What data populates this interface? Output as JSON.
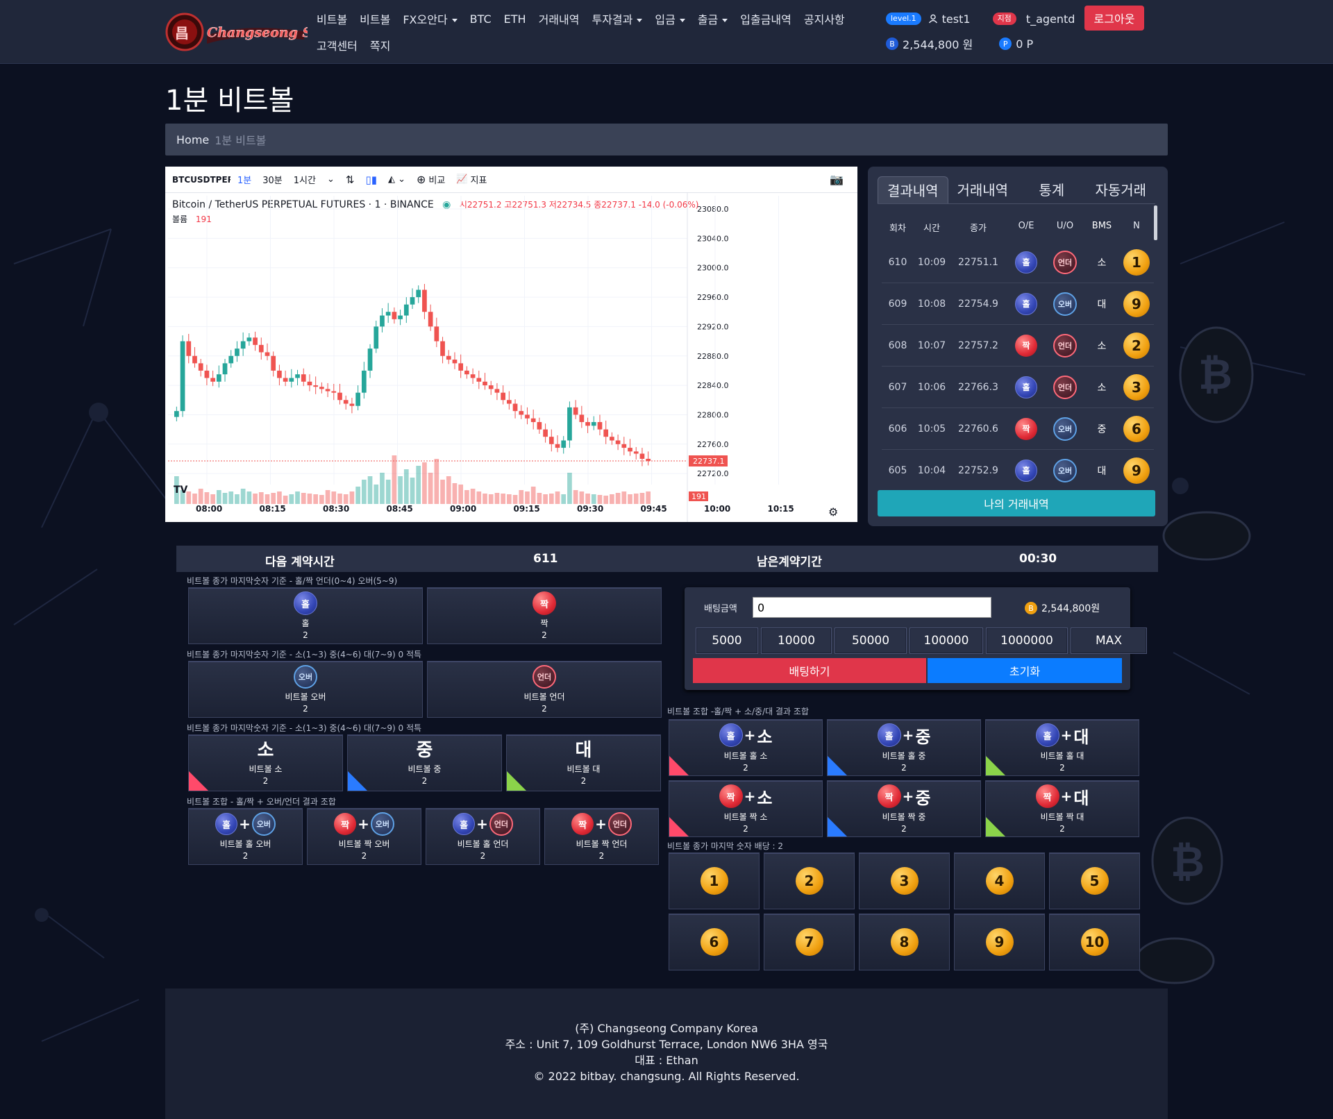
{
  "header": {
    "nav_row1": [
      {
        "label": "비트볼",
        "caret": false
      },
      {
        "label": "비트볼",
        "caret": false
      },
      {
        "label": "FX오안다",
        "caret": true
      },
      {
        "label": "BTC",
        "caret": false
      },
      {
        "label": "ETH",
        "caret": false
      },
      {
        "label": "거래내역",
        "caret": false
      },
      {
        "label": "투자결과",
        "caret": true
      },
      {
        "label": "입금",
        "caret": true
      },
      {
        "label": "출금",
        "caret": true
      },
      {
        "label": "입출금내역",
        "caret": false
      },
      {
        "label": "공지사항",
        "caret": false
      }
    ],
    "nav_row2": [
      "고객센터",
      "쪽지"
    ],
    "level_badge": "level.1",
    "username": "test1",
    "store_badge": "지점",
    "agent": "t_agentd",
    "logout_label": "로그아웃",
    "balance": "2,544,800 원",
    "points": "0 P",
    "balance_coin": "B",
    "points_coin": "P"
  },
  "page": {
    "title": "1분 비트볼",
    "breadcrumb_home": "Home",
    "breadcrumb_current": "1분 비트볼"
  },
  "chart_panel": {
    "symbol": "BTCUSDTPERP",
    "intervals": [
      "1분",
      "30분",
      "1시간"
    ],
    "compare_label": "비교",
    "indicator_label": "지표",
    "info_title": "Bitcoin / TetherUS PERPETUAL FUTURES · 1 · BINANCE",
    "ohlc": "시22751.2 고22751.3 저22734.5 종22737.1 -14.0 (-0.06%)",
    "volume_label": "볼륨",
    "volume_value": "191",
    "last_price_tag": "22737.1",
    "last_volume_tag": "191"
  },
  "chart_data": {
    "type": "candlestick",
    "x_ticks": [
      "08:00",
      "08:15",
      "08:30",
      "08:45",
      "09:00",
      "09:15",
      "09:30",
      "09:45",
      "10:00",
      "10:15"
    ],
    "y_ticks": [
      23080.0,
      23040.0,
      23000.0,
      22960.0,
      22920.0,
      22880.0,
      22840.0,
      22800.0,
      22760.0,
      22720.0
    ],
    "ylim": [
      22705,
      23098
    ],
    "last_price": 22737.1,
    "close_series": [
      22805,
      22900,
      22880,
      22870,
      22860,
      22850,
      22845,
      22855,
      22870,
      22880,
      22890,
      22900,
      22905,
      22895,
      22885,
      22880,
      22860,
      22850,
      22845,
      22850,
      22855,
      22845,
      22840,
      22838,
      22835,
      22832,
      22830,
      22820,
      22815,
      22812,
      22830,
      22860,
      22890,
      22920,
      22935,
      22940,
      22930,
      22935,
      22950,
      22960,
      22970,
      22940,
      22920,
      22900,
      22880,
      22875,
      22870,
      22860,
      22855,
      22850,
      22845,
      22840,
      22835,
      22830,
      22820,
      22815,
      22805,
      22800,
      22795,
      22790,
      22780,
      22770,
      22760,
      22755,
      22765,
      22810,
      22800,
      22790,
      22785,
      22790,
      22780,
      22770,
      22765,
      22760,
      22755,
      22750,
      22747,
      22740,
      22737
    ],
    "volume_series": [
      40,
      20,
      18,
      15,
      22,
      17,
      14,
      20,
      16,
      18,
      14,
      22,
      18,
      15,
      17,
      14,
      16,
      18,
      12,
      14,
      18,
      16,
      15,
      14,
      13,
      20,
      18,
      15,
      14,
      18,
      25,
      35,
      40,
      28,
      45,
      35,
      70,
      40,
      50,
      38,
      55,
      60,
      45,
      65,
      35,
      40,
      30,
      28,
      20,
      22,
      18,
      15,
      14,
      16,
      15,
      14,
      13,
      20,
      18,
      25,
      16,
      14,
      15,
      18,
      14,
      45,
      20,
      18,
      15,
      14,
      13,
      12,
      14,
      16,
      18,
      14,
      15,
      16,
      18
    ]
  },
  "results_panel": {
    "tabs": [
      "결과내역",
      "거래내역",
      "통계",
      "자동거래"
    ],
    "columns": [
      "회차",
      "시간",
      "종가",
      "O/E",
      "U/O",
      "BMS",
      "N"
    ],
    "rows": [
      {
        "round": "610",
        "time": "10:09",
        "close": "22751.1",
        "oe": "홀",
        "oe_type": "blue",
        "uo": "언더",
        "uo_type": "under",
        "bms": "소",
        "n": "1"
      },
      {
        "round": "609",
        "time": "10:08",
        "close": "22754.9",
        "oe": "홀",
        "oe_type": "blue",
        "uo": "오버",
        "uo_type": "over",
        "bms": "대",
        "n": "9"
      },
      {
        "round": "608",
        "time": "10:07",
        "close": "22757.2",
        "oe": "짝",
        "oe_type": "red",
        "uo": "언더",
        "uo_type": "under",
        "bms": "소",
        "n": "2"
      },
      {
        "round": "607",
        "time": "10:06",
        "close": "22766.3",
        "oe": "홀",
        "oe_type": "blue",
        "uo": "언더",
        "uo_type": "under",
        "bms": "소",
        "n": "3"
      },
      {
        "round": "606",
        "time": "10:05",
        "close": "22760.6",
        "oe": "짝",
        "oe_type": "red",
        "uo": "오버",
        "uo_type": "over",
        "bms": "중",
        "n": "6"
      },
      {
        "round": "605",
        "time": "10:04",
        "close": "22752.9",
        "oe": "홀",
        "oe_type": "blue",
        "uo": "오버",
        "uo_type": "over",
        "bms": "대",
        "n": "9"
      }
    ],
    "my_trades_label": "나의 거래내역"
  },
  "contract_bar": {
    "next_label": "다음 계약시간",
    "next_value": "611",
    "remain_label": "남은계약기간",
    "remain_value": "00:30"
  },
  "bets": {
    "oe_label": "비트볼 종가 마지막숫자 기준 - 홀/짝 언더(0~4) 오버(5~9)",
    "oe": [
      {
        "ball": "홀",
        "type": "blue",
        "label": "홀",
        "odds": "2"
      },
      {
        "ball": "짝",
        "type": "red",
        "label": "짝",
        "odds": "2"
      }
    ],
    "uo_label": "비트볼 종가 마지막숫자 기준 - 소(1~3) 중(4~6) 대(7~9) 0 적특",
    "uo": [
      {
        "ball": "오버",
        "type": "over",
        "label": "비트볼 오버",
        "odds": "2"
      },
      {
        "ball": "언더",
        "type": "under",
        "label": "비트볼 언더",
        "odds": "2"
      }
    ],
    "size_label": "비트볼 종가 마지막숫자 기준 - 소(1~3) 중(4~6) 대(7~9) 0 적특",
    "size": [
      {
        "big": "소",
        "label": "비트볼 소",
        "odds": "2",
        "corner": "r"
      },
      {
        "big": "중",
        "label": "비트볼 중",
        "odds": "2",
        "corner": "b"
      },
      {
        "big": "대",
        "label": "비트볼 대",
        "odds": "2",
        "corner": "g"
      }
    ],
    "combo_uo_label": "비트볼 조합 - 홀/짝 + 오버/언더 결과 조합",
    "combo_uo": [
      {
        "a": "홀",
        "a_type": "blue",
        "b": "오버",
        "b_type": "over",
        "label": "비트볼 홀 오버",
        "odds": "2"
      },
      {
        "a": "짝",
        "a_type": "red",
        "b": "오버",
        "b_type": "over",
        "label": "비트볼 짝 오버",
        "odds": "2"
      },
      {
        "a": "홀",
        "a_type": "blue",
        "b": "언더",
        "b_type": "under",
        "label": "비트볼 홀 언더",
        "odds": "2"
      },
      {
        "a": "짝",
        "a_type": "red",
        "b": "언더",
        "b_type": "under",
        "label": "비트볼 짝 언더",
        "odds": "2"
      }
    ],
    "combo_size_label": "비트볼 조합 -홀/짝 + 소/중/대 결과 조합",
    "combo_size": [
      {
        "a": "홀",
        "a_type": "blue",
        "t": "소",
        "label": "비트볼 홀 소",
        "odds": "2",
        "corner": "r"
      },
      {
        "a": "홀",
        "a_type": "blue",
        "t": "중",
        "label": "비트볼 홀 중",
        "odds": "2",
        "corner": "b"
      },
      {
        "a": "홀",
        "a_type": "blue",
        "t": "대",
        "label": "비트볼 홀 대",
        "odds": "2",
        "corner": "g"
      },
      {
        "a": "짝",
        "a_type": "red",
        "t": "소",
        "label": "비트볼 짝 소",
        "odds": "2",
        "corner": "r"
      },
      {
        "a": "짝",
        "a_type": "red",
        "t": "중",
        "label": "비트볼 짝 중",
        "odds": "2",
        "corner": "b"
      },
      {
        "a": "짝",
        "a_type": "red",
        "t": "대",
        "label": "비트볼 짝 대",
        "odds": "2",
        "corner": "g"
      }
    ],
    "number_label": "비트볼 종가 마지막 숫자 배당 : 2",
    "numbers": [
      "1",
      "2",
      "3",
      "4",
      "5",
      "6",
      "7",
      "8",
      "9",
      "10"
    ]
  },
  "bet_form": {
    "amount_label": "배팅금액",
    "amount_value": "0",
    "balance": "2,544,800원",
    "balance_coin": "B",
    "amounts": [
      "5000",
      "10000",
      "50000",
      "100000",
      "1000000",
      "MAX"
    ],
    "bet_label": "배팅하기",
    "reset_label": "초기화"
  },
  "footer": {
    "company": "(주) Changseong Company Korea",
    "address": "주소 : Unit 7, 109 Goldhurst Terrace, London NW6 3HA 영국",
    "ceo": "대표 : Ethan",
    "copyright": "© 2022 bitbay. changsung. All Rights Reserved."
  },
  "colors": {
    "accent_red": "#e0364a",
    "accent_blue": "#0b7cff",
    "teal": "#1fa6b8",
    "candle_up": "#26a69a",
    "candle_down": "#ef5350"
  }
}
